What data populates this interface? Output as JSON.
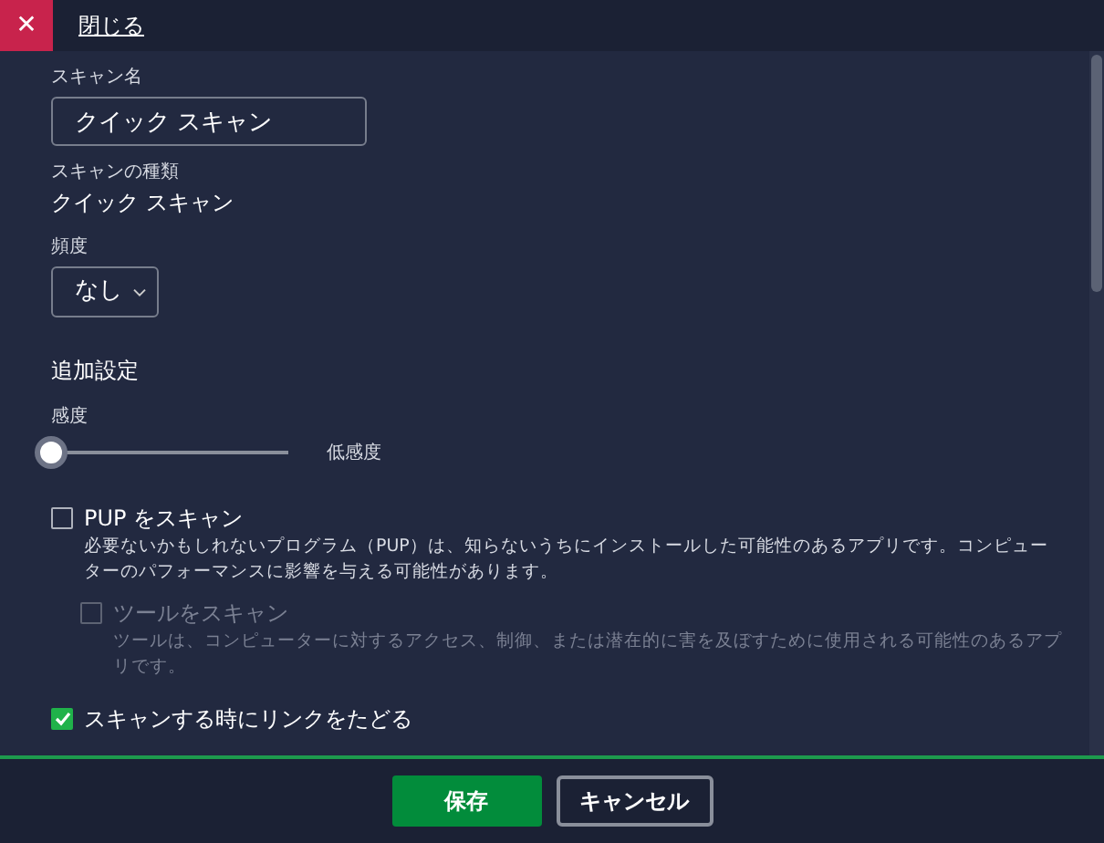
{
  "header": {
    "close_icon": "✕",
    "close_link": "閉じる"
  },
  "scan_name": {
    "label": "スキャン名",
    "value": "クイック スキャン"
  },
  "scan_type": {
    "label": "スキャンの種類",
    "value": "クイック スキャン"
  },
  "frequency": {
    "label": "頻度",
    "value": "なし"
  },
  "advanced": {
    "title": "追加設定",
    "sensitivity": {
      "label": "感度",
      "level": 0,
      "reading": "低感度"
    },
    "options": [
      {
        "label": "PUP をスキャン",
        "checked": false,
        "disabled": false,
        "description": "必要ないかもしれないプログラム（PUP）は、知らないうちにインストールした可能性のあるアプリです。コンピューターのパフォーマンスに影響を与える可能性があります。",
        "children": [
          {
            "label": "ツールをスキャン",
            "checked": false,
            "disabled": true,
            "description": "ツールは、コンピューターに対するアクセス、制御、または潜在的に害を及ぼすために使用される可能性のあるアプリです。"
          }
        ]
      },
      {
        "label": "スキャンする時にリンクをたどる",
        "checked": true,
        "disabled": false
      }
    ]
  },
  "buttons": [
    {
      "label": "保存",
      "kind": "primary"
    },
    {
      "label": "キャンセル",
      "kind": "secondary"
    }
  ]
}
